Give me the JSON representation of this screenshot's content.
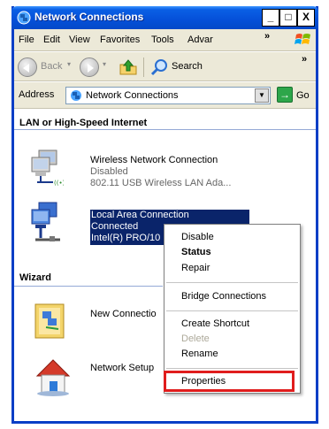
{
  "window": {
    "title": "Network Connections",
    "minimize": "_",
    "maximize": "□",
    "close": "X"
  },
  "menubar": {
    "items": [
      "File",
      "Edit",
      "View",
      "Favorites",
      "Tools",
      "Advar"
    ],
    "overflow": "»"
  },
  "toolbar": {
    "back": "Back",
    "search": "Search",
    "overflow": "»"
  },
  "address": {
    "label": "Address",
    "value": "Network Connections",
    "go": "Go"
  },
  "sections": [
    {
      "title": "LAN or High-Speed Internet"
    },
    {
      "title": "Wizard"
    }
  ],
  "connections": [
    {
      "name": "Wireless Network Connection",
      "status": "Disabled",
      "device": "802.11 USB Wireless LAN Ada..."
    },
    {
      "name": "Local Area Connection",
      "status": "Connected",
      "device": "Intel(R) PRO/10"
    }
  ],
  "wizards": [
    {
      "name": "New Connectio"
    },
    {
      "name": "Network Setup"
    }
  ],
  "context_menu": {
    "items": [
      "Disable",
      "Status",
      "Repair",
      "Bridge Connections",
      "Create Shortcut",
      "Delete",
      "Rename",
      "Properties"
    ],
    "bold_item": "Status",
    "disabled_item": "Delete",
    "highlighted_item": "Properties"
  },
  "colors": {
    "titlebar": "#0550d8",
    "selection": "#0a246a",
    "highlight_box": "#e01d1d"
  }
}
